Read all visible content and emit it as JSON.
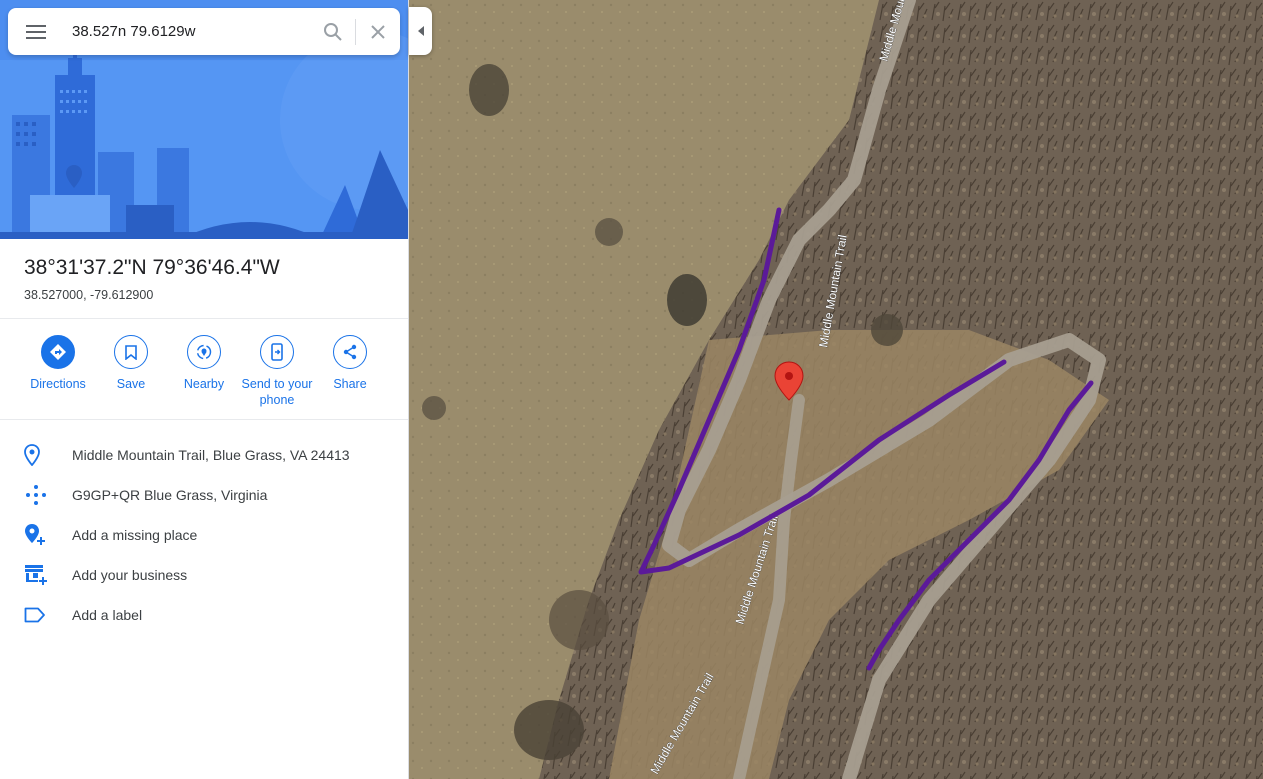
{
  "search": {
    "value": "38.527n 79.6129w",
    "menu_icon": "hamburger-menu-icon",
    "search_icon": "magnifier-icon",
    "clear_icon": "close-icon"
  },
  "place": {
    "title": "38°31'37.2\"N 79°36'46.4\"W",
    "decimal": "38.527000, -79.612900"
  },
  "actions": [
    {
      "label": "Directions",
      "icon": "directions-icon"
    },
    {
      "label": "Save",
      "icon": "bookmark-icon"
    },
    {
      "label": "Nearby",
      "icon": "nearby-icon"
    },
    {
      "label_line1": "Send to your",
      "label_line2": "phone",
      "icon": "send-to-phone-icon"
    },
    {
      "label": "Share",
      "icon": "share-icon"
    }
  ],
  "info": [
    {
      "text": "Middle Mountain Trail, Blue Grass, VA 24413",
      "icon": "location-pin-icon"
    },
    {
      "text": "G9GP+QR Blue Grass, Virginia",
      "icon": "plus-code-icon"
    },
    {
      "text": "Add a missing place",
      "icon": "add-place-icon"
    },
    {
      "text": "Add your business",
      "icon": "add-business-icon"
    },
    {
      "text": "Add a label",
      "icon": "label-icon"
    }
  ],
  "map": {
    "road_labels": [
      "Middle Mountain Trail",
      "Middle Mountain Trail",
      "Middle Mountain Trail",
      "Middle Mountain Trail"
    ],
    "marker_color": "#ea4335",
    "annotation_color": "#5b1a99"
  },
  "colors": {
    "accent": "#1a73e8",
    "hero_bg": "#4d8ef0"
  }
}
